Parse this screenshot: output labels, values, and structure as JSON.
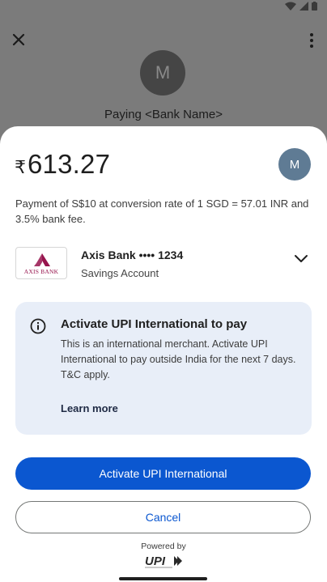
{
  "background": {
    "avatar_letter": "M",
    "title": "Paying <Bank Name>"
  },
  "sheet": {
    "currency_symbol": "₹",
    "amount": "613.27",
    "payee_avatar_letter": "M",
    "conversion_text": "Payment of S$10 at conversion rate of 1 SGD = 57.01 INR and 3.5% bank fee.",
    "account": {
      "bank_logo_text": "AXIS BANK",
      "bank_name": "Axis Bank •••• 1234",
      "account_type": "Savings Account"
    },
    "info_card": {
      "title": "Activate UPI International to pay",
      "body": "This is an international merchant. Activate UPI International to pay outside India for the next 7 days. T&C apply.",
      "learn_more": "Learn more"
    },
    "primary_button": "Activate UPI International",
    "secondary_button": "Cancel",
    "powered_by": "Powered by",
    "upi_logo_text": "UPI"
  },
  "colors": {
    "primary": "#0b57d0",
    "info_card_bg": "#e8eef8",
    "axis_brand": "#97144d",
    "payee_avatar_bg": "#5f7b94"
  }
}
